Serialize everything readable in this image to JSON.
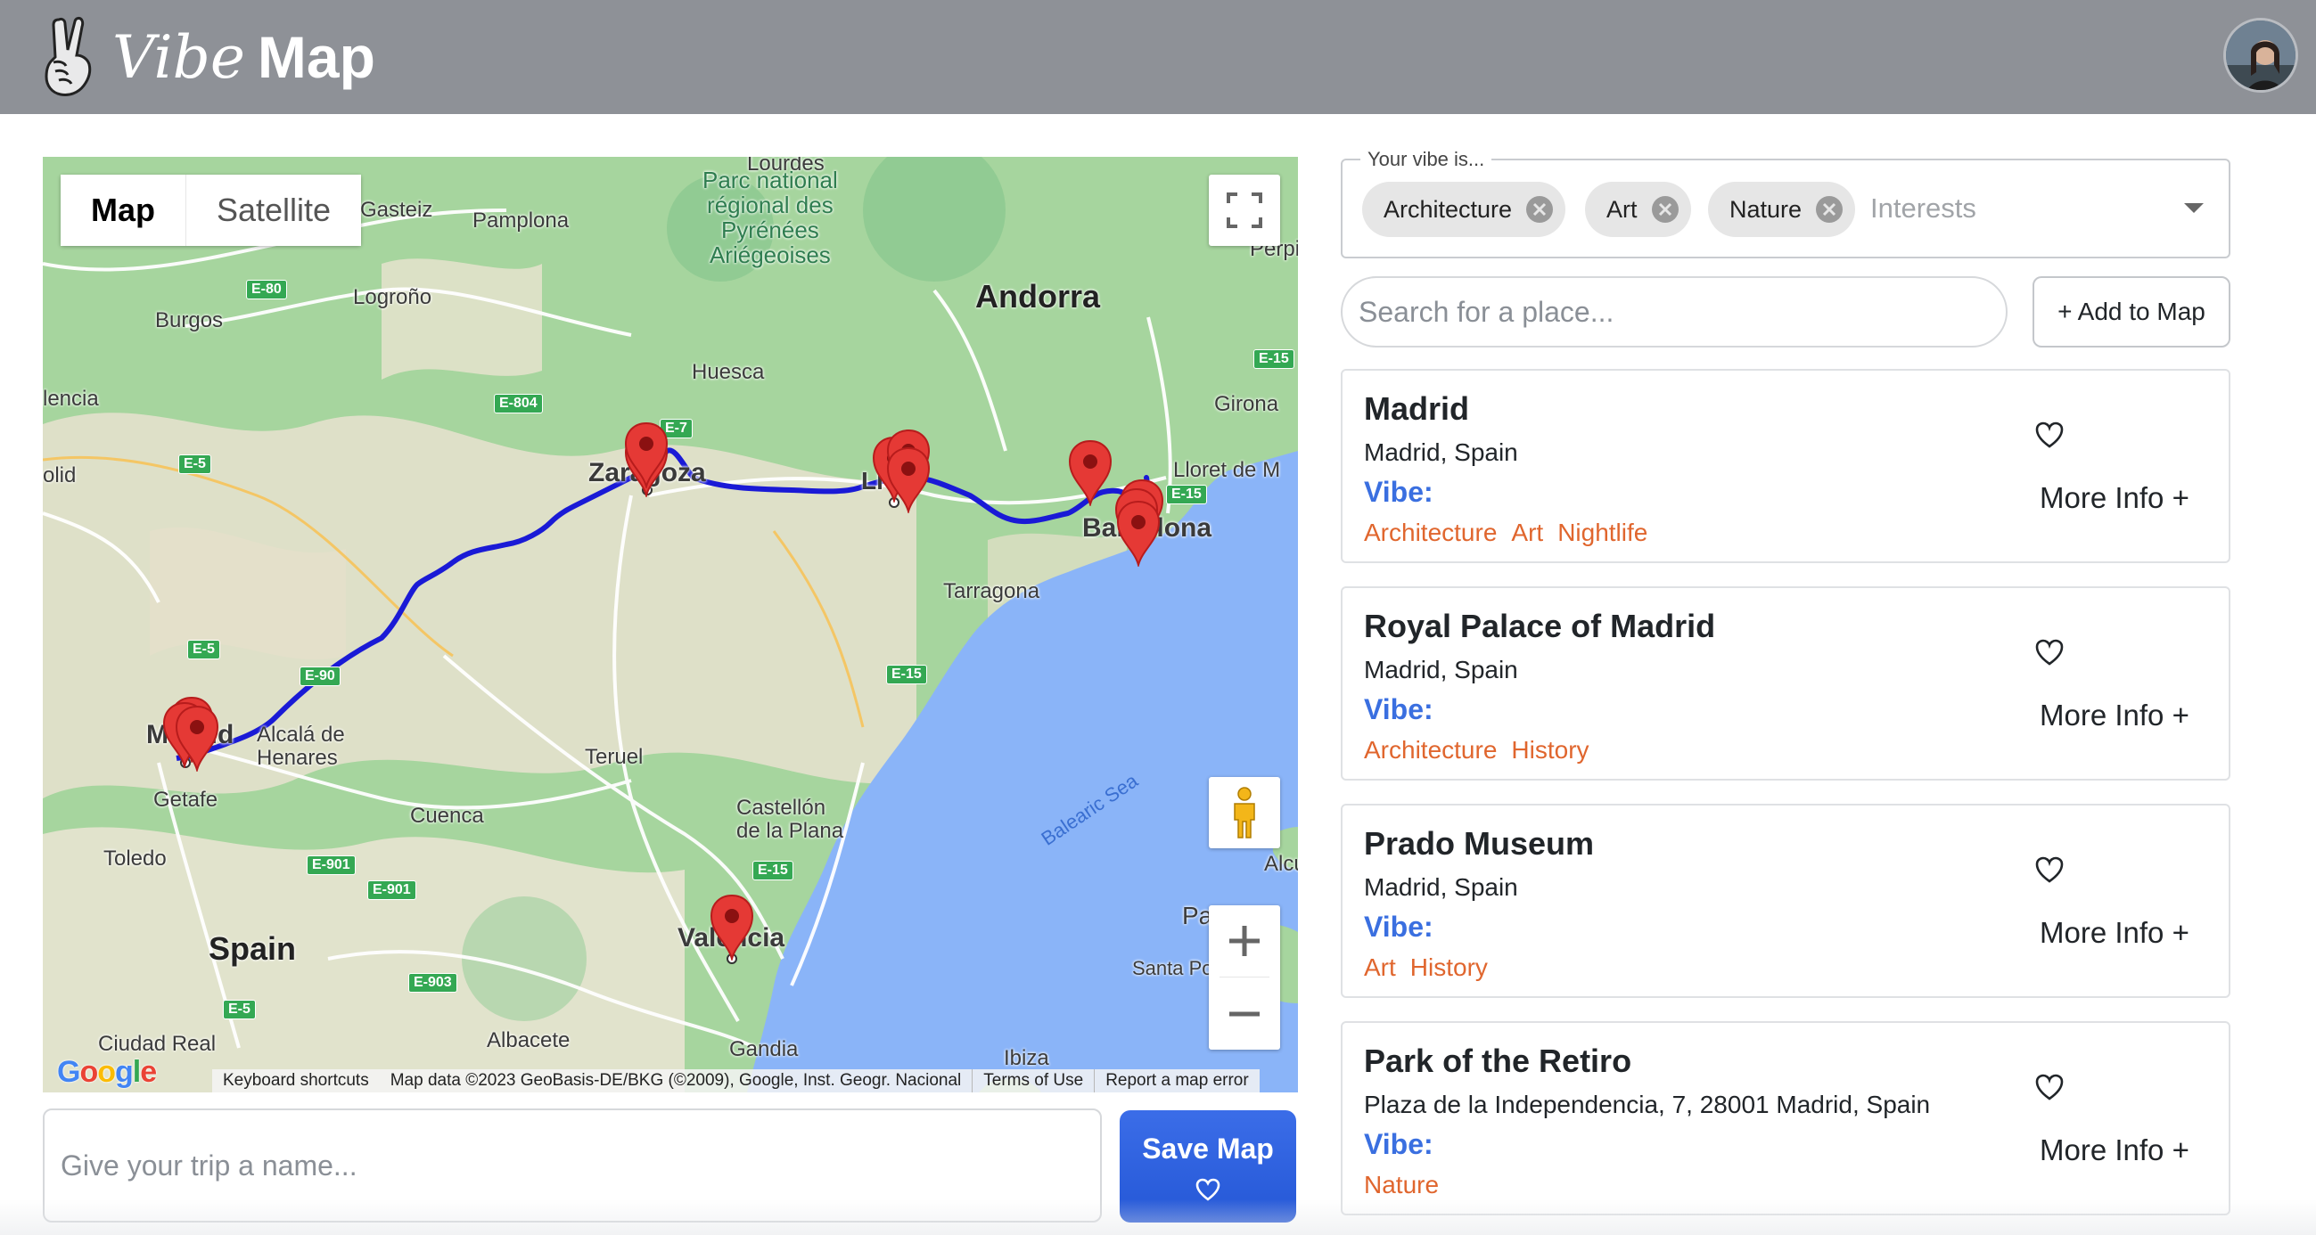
{
  "header": {
    "logo_vibe": "Vibe",
    "logo_map": "Map",
    "logo_icon": "peace-hand-icon",
    "avatar_icon": "user-avatar"
  },
  "map": {
    "type_buttons": [
      "Map",
      "Satellite"
    ],
    "active_type": "Map",
    "labels": {
      "lourdes": "Lourdes",
      "gasteiz": "Gasteiz",
      "pamplona": "Pamplona",
      "park": "Parc national\nrégional des\nPyrénées\nAriégeoises",
      "perpignan": "Perpign",
      "burgos": "Burgos",
      "logrono": "Logroño",
      "andorra": "Andorra",
      "huesca": "Huesca",
      "girona": "Girona",
      "palencia": "lencia",
      "lloret": "Lloret de M",
      "valladolid": "olid",
      "zaragoza": "Zaragoza",
      "lleida": "Ll",
      "barcelona": "Barcelona",
      "tarragona": "Tarragona",
      "madrid": "Madrid",
      "alcala": "Alcalá de\nHenares",
      "getafe": "Getafe",
      "teruel": "Teruel",
      "cuenca": "Cuenca",
      "castellon": "Castellón\nde la Plana",
      "balearic": "Balearic Sea",
      "alcudia": "Alcu",
      "toledo": "Toledo",
      "spain": "Spain",
      "valencia": "Valencia",
      "palma": "Pa",
      "santa_ponsa": "Santa Pons",
      "ciudad_real": "Ciudad Real",
      "albacete": "Albacete",
      "gandia": "Gandia",
      "ibiza": "Ibiza"
    },
    "road_shields": [
      "E-80",
      "E-7",
      "E-804",
      "E-15",
      "E-5",
      "E-15",
      "E-5",
      "E-90",
      "E-15",
      "E-15",
      "E-901",
      "E-901",
      "E-903",
      "E-5"
    ],
    "google": "Google",
    "attribution": {
      "keyboard": "Keyboard shortcuts",
      "data": "Map data ©2023 GeoBasis-DE/BKG (©2009), Google, Inst. Geogr. Nacional",
      "terms": "Terms of Use",
      "report": "Report a map error"
    },
    "icons": [
      "fullscreen-icon",
      "pegman-icon",
      "zoom-in-icon",
      "zoom-out-icon",
      "map-pin-icon"
    ],
    "route_color": "#1a1ad6",
    "pin_color": "#e53935"
  },
  "trip": {
    "name_placeholder": "Give your trip a name...",
    "name_value": "",
    "save_label": "Save Map"
  },
  "vibe": {
    "legend": "Your vibe is...",
    "chips": [
      "Architecture",
      "Art",
      "Nature"
    ],
    "interests_placeholder": "Interests"
  },
  "search": {
    "placeholder": "Search for a place...",
    "add_label": "+ Add to Map"
  },
  "places": [
    {
      "name": "Madrid",
      "address": "Madrid, Spain",
      "vibe_label": "Vibe:",
      "tags": [
        "Architecture",
        "Art",
        "Nightlife"
      ],
      "more": "More Info +"
    },
    {
      "name": "Royal Palace of Madrid",
      "address": "Madrid, Spain",
      "vibe_label": "Vibe:",
      "tags": [
        "Architecture",
        "History"
      ],
      "more": "More Info +"
    },
    {
      "name": "Prado Museum",
      "address": "Madrid, Spain",
      "vibe_label": "Vibe:",
      "tags": [
        "Art",
        "History"
      ],
      "more": "More Info +"
    },
    {
      "name": "Park of the Retiro",
      "address": "Plaza de la Independencia, 7, 28001 Madrid, Spain",
      "vibe_label": "Vibe:",
      "tags": [
        "Nature"
      ],
      "more": "More Info +"
    }
  ],
  "colors": {
    "header_bg": "#8e9197",
    "accent_blue": "#2f63e0",
    "tag_orange": "#e0662e",
    "sea": "#8ab4f8",
    "land": "#a6d59e"
  }
}
